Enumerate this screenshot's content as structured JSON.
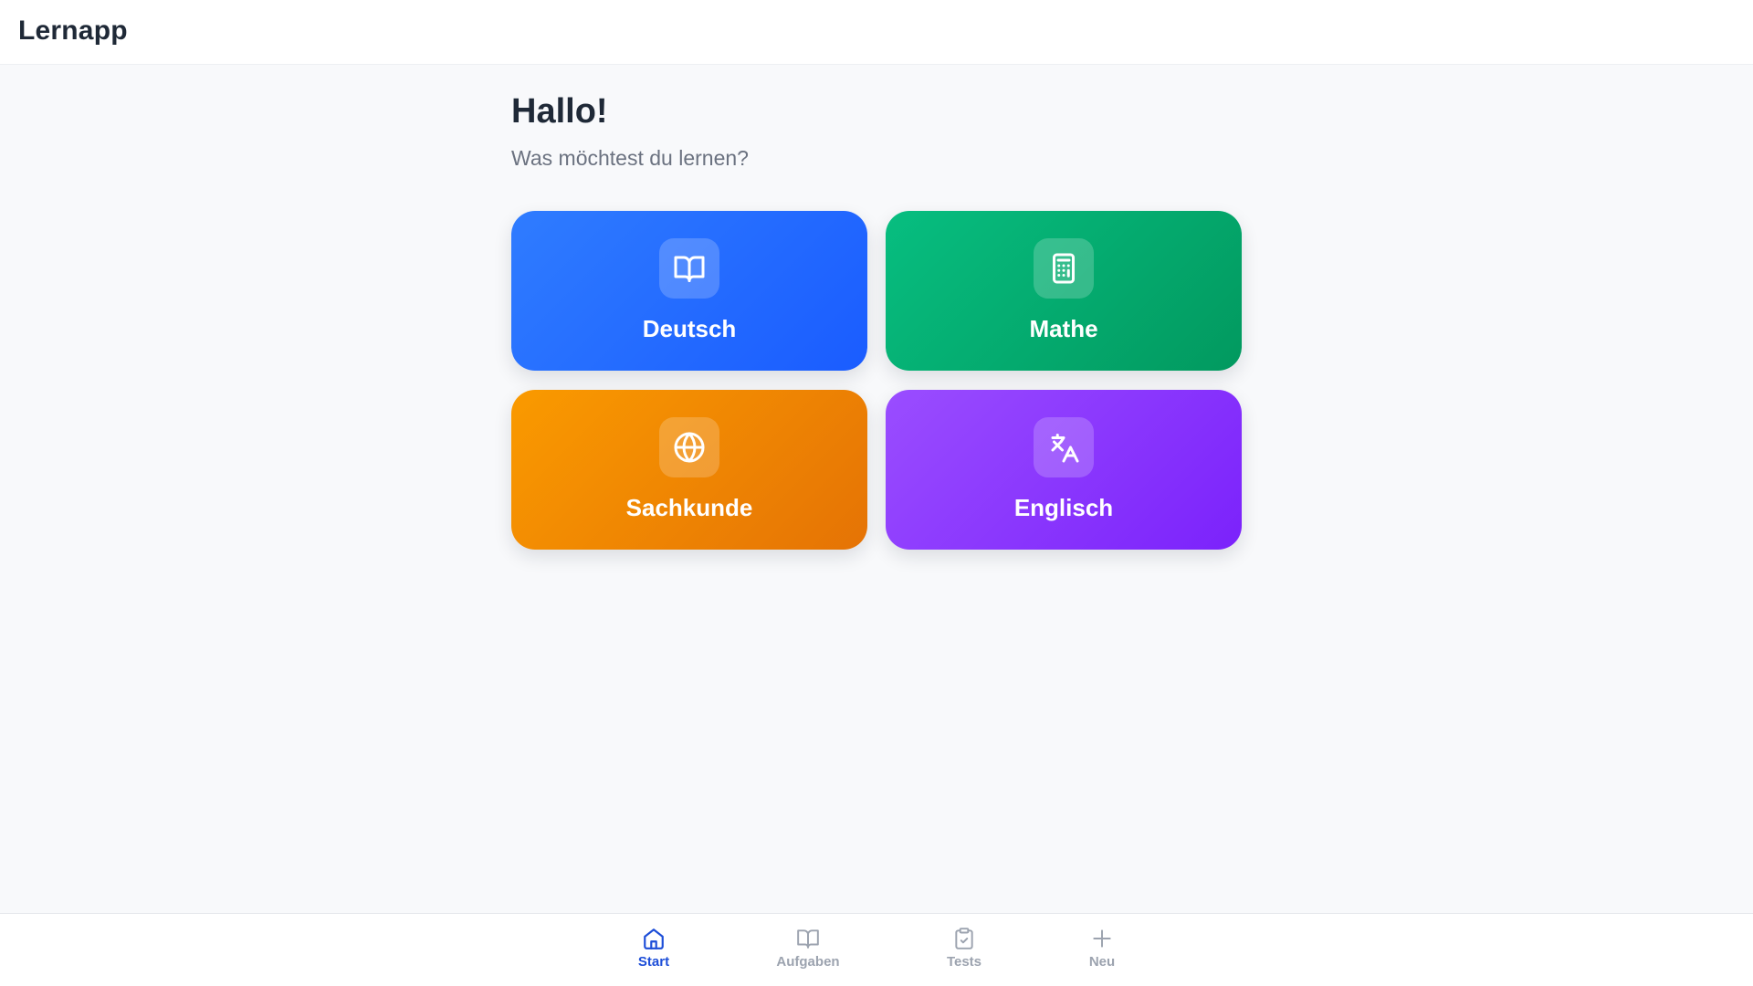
{
  "header": {
    "title": "Lernapp"
  },
  "main": {
    "greeting": "Hallo!",
    "subtitle": "Was möchtest du lernen?"
  },
  "subjects": [
    {
      "label": "Deutsch",
      "icon": "book-open-icon",
      "color_start": "#2f7cff",
      "color_end": "#1a5cff"
    },
    {
      "label": "Mathe",
      "icon": "calculator-icon",
      "color_start": "#07be80",
      "color_end": "#02995f"
    },
    {
      "label": "Sachkunde",
      "icon": "globe-icon",
      "color_start": "#fa9a00",
      "color_end": "#e57305"
    },
    {
      "label": "Englisch",
      "icon": "translate-icon",
      "color_start": "#9a4dff",
      "color_end": "#7b22fb"
    }
  ],
  "bottom_nav": {
    "items": [
      {
        "label": "Start",
        "icon": "home-icon",
        "active": true
      },
      {
        "label": "Aufgaben",
        "icon": "book-open-icon",
        "active": false
      },
      {
        "label": "Tests",
        "icon": "clipboard-check-icon",
        "active": false
      },
      {
        "label": "Neu",
        "icon": "plus-icon",
        "active": false
      }
    ],
    "active_color": "#1d4ed8",
    "inactive_color": "#9ca3af"
  }
}
